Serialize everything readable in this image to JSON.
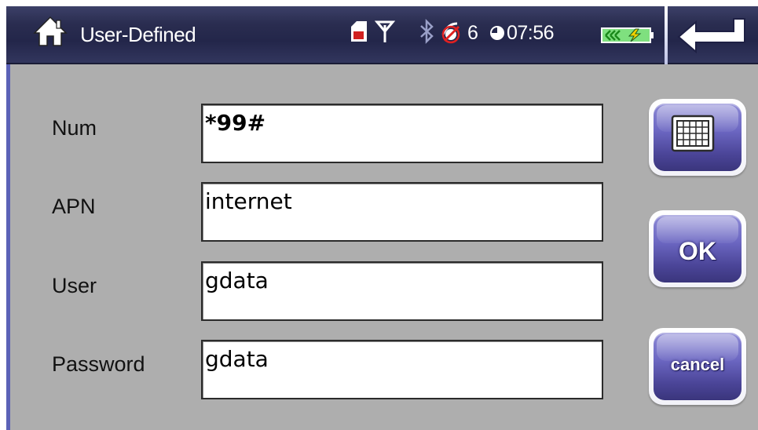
{
  "header": {
    "title": "User-Defined",
    "satellite_count": "6",
    "time": "07:56",
    "icons": [
      "home-icon",
      "sim-card-icon",
      "antenna-icon",
      "bluetooth-icon",
      "gps-satellite-icon",
      "clock-icon",
      "battery-charging-icon",
      "back-arrow-icon"
    ]
  },
  "form": {
    "num_label": "Num",
    "num_value": "*99#",
    "apn_label": "APN",
    "apn_value": "internet",
    "user_label": "User",
    "user_value": "gdata",
    "password_label": "Password",
    "password_value": "gdata"
  },
  "buttons": {
    "keyboard_icon": "keyboard-icon",
    "ok_label": "OK",
    "cancel_label": "cancel"
  },
  "colors": {
    "header_bg": "#2a2d50",
    "panel_bg": "#aeaeae",
    "button_purple": "#6c67c2",
    "accent_blue": "#5b62b7"
  }
}
